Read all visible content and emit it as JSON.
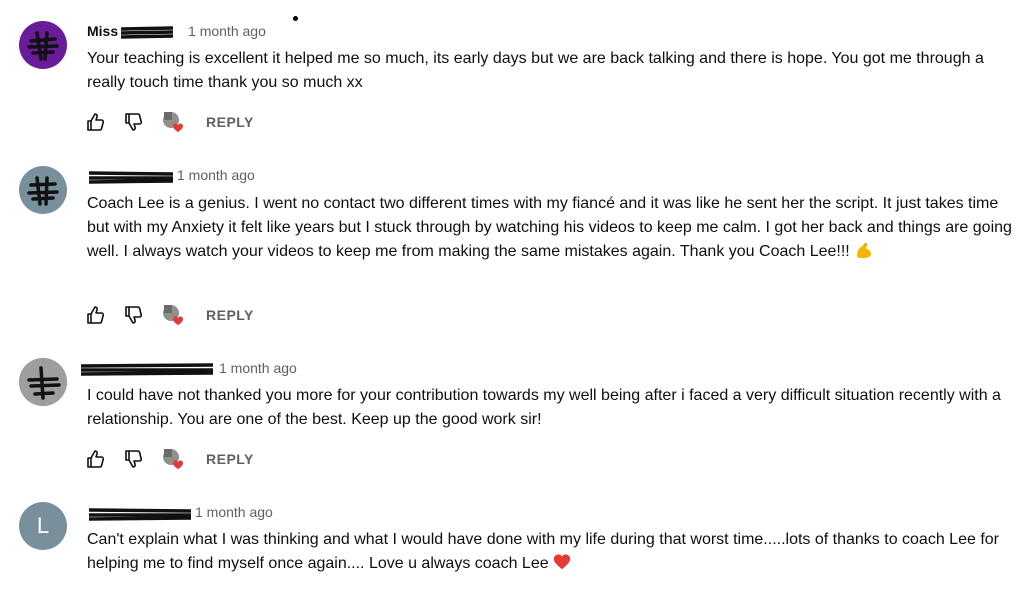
{
  "comments": [
    {
      "author": "Miss",
      "time": "1 month ago",
      "text": "Your teaching is excellent it helped me so much, its early days but we are back talking and there is hope. You got me through a really touch time thank you so much xx",
      "reply_label": "REPLY",
      "avatar_color": "#6a1b9a"
    },
    {
      "author": "",
      "time": "1 month ago",
      "text": "Coach Lee is a genius. I went no contact two different times with my fiancé and it was like he sent her the script. It just takes time but with my Anxiety it felt like years but I stuck through by watching his videos to keep me calm. I got her back and things are going well. I always watch your videos to keep me from making the same mistakes again. Thank you Coach Lee!!!",
      "emoji": "flexed-biceps",
      "reply_label": "REPLY",
      "avatar_color": "#78909c"
    },
    {
      "author": "",
      "time": "1 month ago",
      "text": "I could have not thanked you more for your contribution towards my well being after i faced a very difficult situation recently with a relationship. You are one of the best. Keep up the good work sir!",
      "reply_label": "REPLY",
      "avatar_color": "#8d8d8d"
    },
    {
      "author": "",
      "time": "1 month ago",
      "avatar_letter": "L",
      "text": "Can't explain what I was thinking and what I would have done with my life during that worst time.....lots of thanks to coach Lee for helping me to find myself once again.... Love u always coach Lee",
      "emoji": "red-heart",
      "avatar_color": "#78909c"
    }
  ],
  "icons": [
    "like-icon",
    "dislike-icon",
    "creator-heart-icon",
    "flexed-biceps-emoji",
    "red-heart-emoji"
  ],
  "colors": {
    "heart": "#e53935",
    "secondary_text": "#606060"
  }
}
